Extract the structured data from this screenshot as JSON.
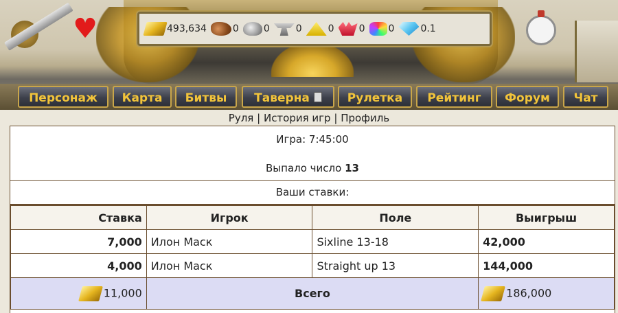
{
  "resources": [
    {
      "icon": "gold-bars-icon",
      "value": "493,634"
    },
    {
      "icon": "wood-icon",
      "value": "0"
    },
    {
      "icon": "stone-icon",
      "value": "0"
    },
    {
      "icon": "anvil-icon",
      "value": "0"
    },
    {
      "icon": "sulfur-icon",
      "value": "0"
    },
    {
      "icon": "crystal-icon",
      "value": "0"
    },
    {
      "icon": "gems-icon",
      "value": "0"
    },
    {
      "icon": "diamond-icon",
      "value": "0.1"
    }
  ],
  "nav": {
    "character": "Персонаж",
    "map": "Карта",
    "battles": "Битвы",
    "tavern": "Таверна",
    "roulette": "Рулетка",
    "rating": "Рейтинг",
    "forum": "Форум",
    "chat": "Чат"
  },
  "subnav": {
    "roulette": "Руля",
    "history": "История игр",
    "profile": "Профиль",
    "sep": "|"
  },
  "game": {
    "time_label": "Игра: 7:45:00",
    "result_label": "Выпало число",
    "result_number": "13"
  },
  "bets": {
    "title": "Ваши ставки:",
    "columns": {
      "stake": "Ставка",
      "player": "Игрок",
      "field": "Поле",
      "win": "Выигрыш"
    },
    "rows": [
      {
        "stake": "7,000",
        "player": "Илон Маск",
        "field": "Sixline 13-18",
        "win": "42,000"
      },
      {
        "stake": "4,000",
        "player": "Илон Маск",
        "field": "Straight up 13",
        "win": "144,000"
      }
    ],
    "total": {
      "stake": "11,000",
      "label": "Всего",
      "win": "186,000"
    }
  },
  "colors": {
    "nav_text": "#f2c43a",
    "total_row_bg": "#dcdcf4",
    "border": "#6a4d2e"
  }
}
